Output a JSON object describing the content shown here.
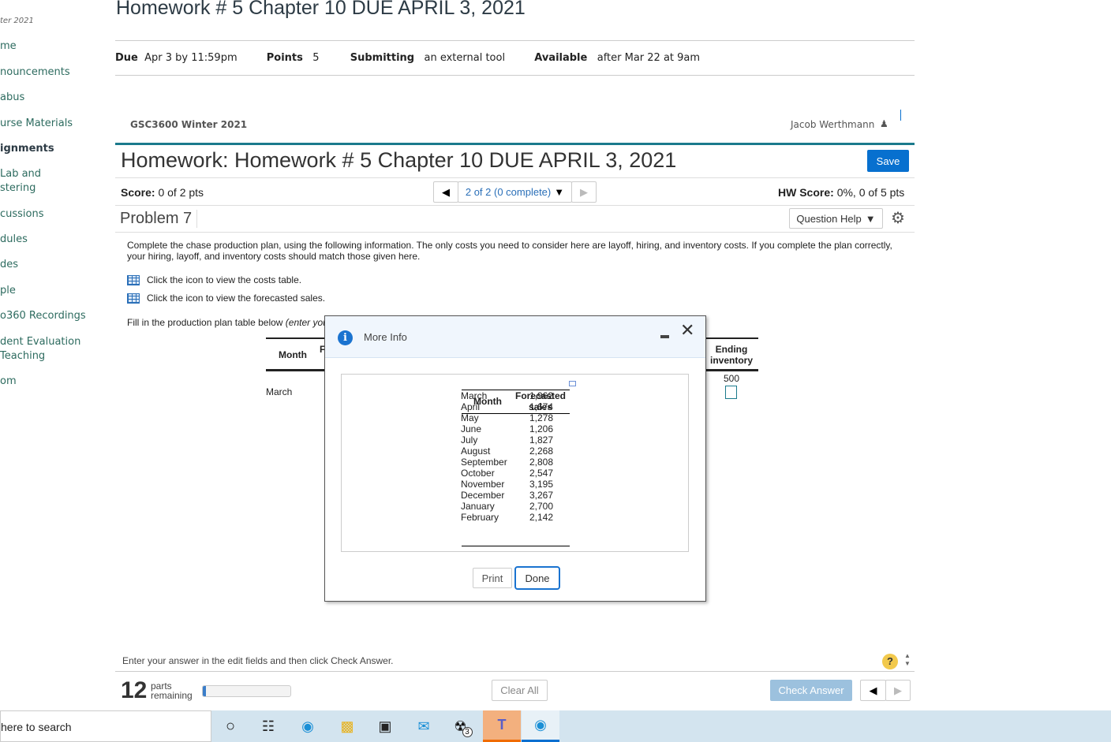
{
  "sidebar": {
    "term": "ter 2021",
    "items": [
      "me",
      "nouncements",
      "abus",
      "urse Materials",
      "ignments",
      "Lab and\nstering",
      "cussions",
      "dules",
      "des",
      "ple",
      "o360 Recordings",
      "dent Evaluation\nTeaching",
      "om"
    ],
    "active": "ignments"
  },
  "assignment": {
    "title": "Homework # 5 Chapter 10 DUE APRIL 3, 2021",
    "due_label": "Due",
    "due": "Apr 3 by 11:59pm",
    "points_label": "Points",
    "points": "5",
    "submitting_label": "Submitting",
    "submitting": "an external tool",
    "available_label": "Available",
    "available": "after Mar 22 at 9am"
  },
  "mml": {
    "course": "GSC3600 Winter 2021",
    "user": "Jacob Werthmann",
    "hw_title": "Homework: Homework # 5 Chapter 10 DUE APRIL 3, 2021",
    "save": "Save",
    "score_label": "Score:",
    "score": "0 of 2 pts",
    "nav_status": "2 of 2 (0 complete)",
    "hw_score_label": "HW Score:",
    "hw_score": "0%, 0 of 5 pts",
    "problem": "Problem 7",
    "question_help": "Question Help",
    "instructions": "Complete the chase production plan, using the following information. The only costs you need to consider here are layoff, hiring, and inventory costs. If you complete the plan correctly, your hiring, layoff, and inventory costs should match those given here.",
    "costs_link": "Click the icon to view the costs table.",
    "sales_link": "Click the icon to view the forecasted sales.",
    "fill_text": "Fill in the production plan table below ",
    "fill_italic": "(enter you",
    "table": {
      "month_header": "Month",
      "col2_partial": "F",
      "ending_header": "Ending inventory",
      "first_month": "March",
      "initial_inventory": "500"
    },
    "bottom_text": "Enter your answer in the edit fields and then click Check Answer.",
    "parts_count": "12",
    "parts_label1": "parts",
    "parts_label2": "remaining",
    "progress": 0.04,
    "clear_all": "Clear All",
    "check_answer": "Check Answer"
  },
  "modal": {
    "title": "More Info",
    "headers": [
      "Month",
      "Forecasted sales"
    ],
    "rows": [
      [
        "March",
        "1,962"
      ],
      [
        "April",
        "1,674"
      ],
      [
        "May",
        "1,278"
      ],
      [
        "June",
        "1,206"
      ],
      [
        "July",
        "1,827"
      ],
      [
        "August",
        "2,268"
      ],
      [
        "September",
        "2,808"
      ],
      [
        "October",
        "2,547"
      ],
      [
        "November",
        "3,195"
      ],
      [
        "December",
        "3,267"
      ],
      [
        "January",
        "2,700"
      ],
      [
        "February",
        "2,142"
      ]
    ],
    "print": "Print",
    "done": "Done"
  },
  "taskbar": {
    "search": "here to search",
    "teams_badge": "3"
  },
  "colors": {
    "accent": "#0770cf",
    "teal": "#1b7a8c",
    "taskbar": "#d3e4ef"
  }
}
